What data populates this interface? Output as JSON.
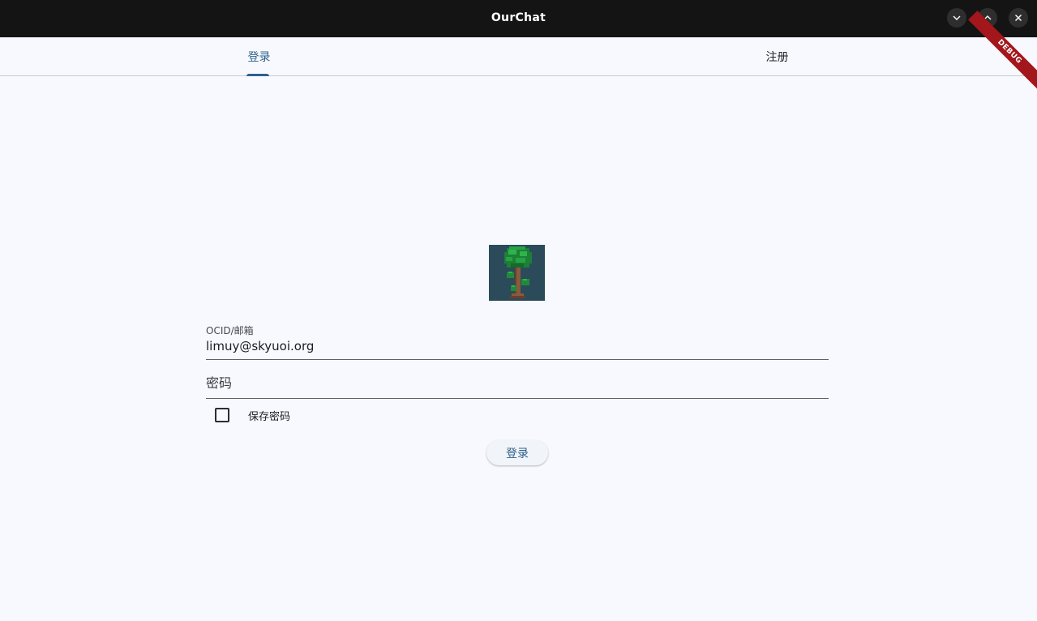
{
  "window": {
    "title": "OurChat",
    "controls": [
      "minimize-icon",
      "maximize-icon",
      "close-icon"
    ]
  },
  "tabs": [
    {
      "label": "登录",
      "selected": true
    },
    {
      "label": "注册",
      "selected": false
    }
  ],
  "debug_banner": "DEBUG",
  "form": {
    "account_label": "OCID/邮箱",
    "account_value": "limuy@skyuoi.org",
    "password_placeholder": "密码",
    "remember_label": "保存密码",
    "remember_checked": false,
    "submit_label": "登录"
  },
  "colors": {
    "accent": "#2f5f8a",
    "titlebar": "#141414",
    "background": "#f7f9fe",
    "debug": "#a3161b"
  }
}
